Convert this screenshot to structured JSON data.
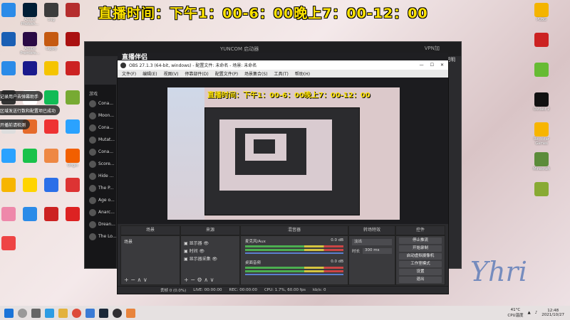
{
  "banner": "直播时间：下午1：00-6：00晚上7：00-12：00",
  "desktop_left": [
    {
      "label": "",
      "color": "#2b8be8"
    },
    {
      "label": "Adobe Photosh...",
      "color": "#001e36"
    },
    {
      "label": "bug",
      "color": "#3c3c3c"
    },
    {
      "label": "",
      "color": "#b52d2d"
    },
    {
      "label": "",
      "color": "#1a5fb4"
    },
    {
      "label": "Adobe Premiere...",
      "color": "#2a0b45"
    },
    {
      "label": "tapjoy",
      "color": "#c55a11"
    },
    {
      "label": "",
      "color": "#a11"
    },
    {
      "label": "",
      "color": "#2b8be8"
    },
    {
      "label": "",
      "color": "#1a1a8c"
    },
    {
      "label": "",
      "color": "#f5c400"
    },
    {
      "label": "",
      "color": "#c22"
    },
    {
      "label": "",
      "color": "#333"
    },
    {
      "label": "",
      "color": "#fff"
    },
    {
      "label": "",
      "color": "#1b5"
    },
    {
      "label": "",
      "color": "#7a3"
    },
    {
      "label": "",
      "color": "#ddd"
    },
    {
      "label": "",
      "color": "#e56b2b"
    },
    {
      "label": "",
      "color": "#e33"
    },
    {
      "label": "",
      "color": "#2aa2ff"
    },
    {
      "label": "",
      "color": "#2aa2ff"
    },
    {
      "label": "",
      "color": "#19c24a"
    },
    {
      "label": "",
      "color": "#e84"
    },
    {
      "label": "Origin",
      "color": "#f25f00"
    },
    {
      "label": "",
      "color": "#f7b500"
    },
    {
      "label": "",
      "color": "#ffd400"
    },
    {
      "label": "",
      "color": "#2b6fe8"
    },
    {
      "label": "",
      "color": "#d33"
    },
    {
      "label": "",
      "color": "#e8a"
    },
    {
      "label": "",
      "color": "#2b8be8"
    },
    {
      "label": "",
      "color": "#c22"
    },
    {
      "label": "",
      "color": "#d22"
    },
    {
      "label": "",
      "color": "#e44"
    }
  ],
  "desktop_right": [
    {
      "label": "PUBG",
      "color": "#f4b400"
    },
    {
      "label": "",
      "color": "#c22"
    },
    {
      "label": "",
      "color": "#6b3"
    },
    {
      "label": "Outlast 2",
      "color": "#111"
    },
    {
      "label": "Rockstar Games",
      "color": "#f7b500"
    },
    {
      "label": "Minecraft",
      "color": "#5b8c3a"
    },
    {
      "label": "",
      "color": "#8a3"
    }
  ],
  "toasts": [
    "记录用户去弹幕助手",
    "区域发送行数和配置项已成功",
    "开播前请检测"
  ],
  "back_window": {
    "title": "YUNCOM 启动器",
    "app_name": "VPN加",
    "user": "补丁说明",
    "nav_label": "游戏",
    "games": [
      "Cona...",
      "Moon...",
      "Cona...",
      "Mutat...",
      "Cona...",
      "Score...",
      "Hide ...",
      "The P...",
      "Age o...",
      "Anarc...",
      "Drean...",
      "The Lo..."
    ]
  },
  "obs": {
    "appbar_title": "直播伴侣",
    "title": "OBS 27.1.3 (64-bit, windows) - 配置文件: 未命名 - 场景: 未命名",
    "menu": [
      "文件(F)",
      "编辑(E)",
      "视图(V)",
      "停靠部件(D)",
      "配置文件(P)",
      "场景集合(S)",
      "工具(T)",
      "帮助(H)"
    ],
    "dock_headers": [
      "场景",
      "来源",
      "混音器",
      "转场特效",
      "控件"
    ],
    "scenes": [
      "场景"
    ],
    "sources": [
      "显示器",
      "时间",
      "显示器采集"
    ],
    "mixer": [
      {
        "name": "麦克风/Aux",
        "db": "0.0 dB"
      },
      {
        "name": "桌面音频",
        "db": "0.0 dB"
      }
    ],
    "transition": {
      "type": "淡出",
      "duration_label": "时长",
      "duration": "300 ms"
    },
    "controls": [
      "停止推流",
      "开始录制",
      "启动虚拟摄像机",
      "工作室模式",
      "设置",
      "退出"
    ],
    "status": [
      "丢帧 0 (0.0%)",
      "LIVE: 00:00:00",
      "REC: 00:00:00",
      "CPU: 1.7%, 60.00 fps",
      "kb/s: 0"
    ],
    "preview_overlay": "直播时间：下午1：00-6：00晚上7：00-12：00"
  },
  "tray": {
    "temp": "41°C",
    "cpu": "CPU温度",
    "time": "12:48",
    "date": "2021/10/27"
  },
  "watermark": "Yhri"
}
